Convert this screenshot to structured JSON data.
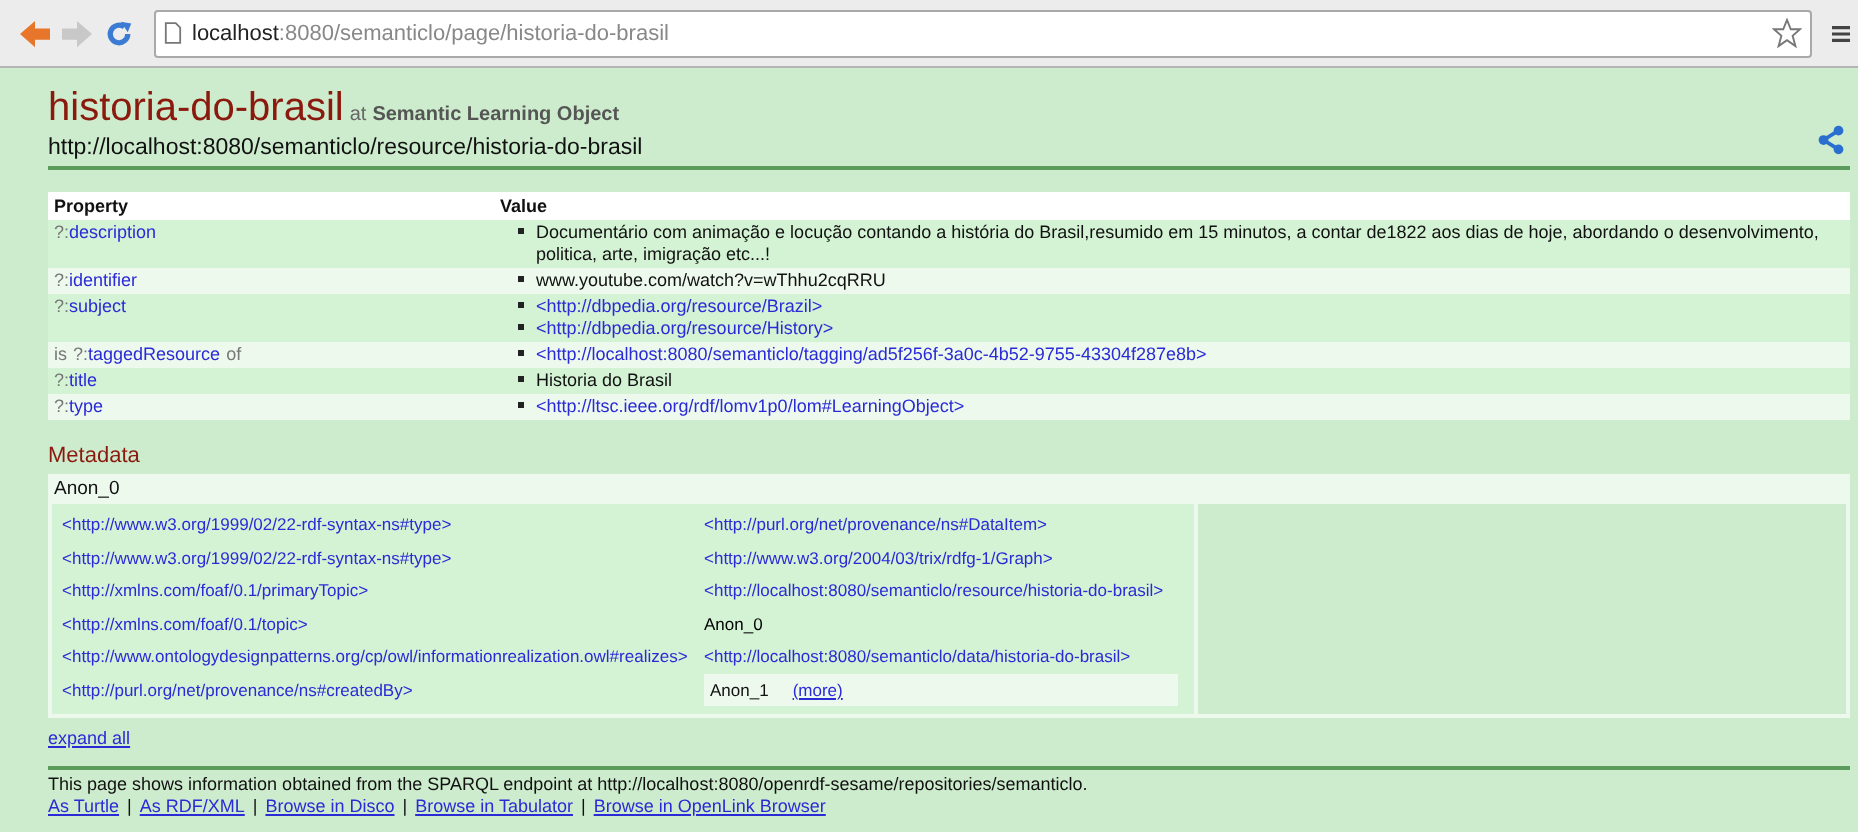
{
  "browser": {
    "url_host": "localhost",
    "url_path": ":8080/semanticlo/page/historia-do-brasil"
  },
  "header": {
    "title": "historia-do-brasil",
    "at": "at",
    "site": "Semantic Learning Object",
    "resource": "http://localhost:8080/semanticlo/resource/historia-do-brasil"
  },
  "properties": {
    "columns": [
      "Property",
      "Value"
    ],
    "rows": [
      {
        "property": {
          "prefix": "?:",
          "name": "description"
        },
        "values": [
          {
            "kind": "text",
            "text": "Documentário com animação e locução contando a história do Brasil,resumido em 15 minutos, a contar de1822 aos dias de hoje, abordando o desenvolvimento, politica, arte, imigração etc...!"
          }
        ]
      },
      {
        "property": {
          "prefix": "?:",
          "name": "identifier"
        },
        "values": [
          {
            "kind": "text",
            "text": "www.youtube.com/watch?v=wThhu2cqRRU"
          }
        ]
      },
      {
        "property": {
          "prefix": "?:",
          "name": "subject"
        },
        "values": [
          {
            "kind": "link",
            "text": "<http://dbpedia.org/resource/Brazil>"
          },
          {
            "kind": "link",
            "text": "<http://dbpedia.org/resource/History>"
          }
        ]
      },
      {
        "inverse_property": {
          "before": "is",
          "prefix": "?:",
          "name": "taggedResource",
          "after": "of"
        },
        "values": [
          {
            "kind": "link",
            "text": "<http://localhost:8080/semanticlo/tagging/ad5f256f-3a0c-4b52-9755-43304f287e8b>"
          }
        ]
      },
      {
        "property": {
          "prefix": "?:",
          "name": "title"
        },
        "values": [
          {
            "kind": "text",
            "text": "Historia do Brasil"
          }
        ]
      },
      {
        "property": {
          "prefix": "?:",
          "name": "type"
        },
        "values": [
          {
            "kind": "link",
            "text": "<http://ltsc.ieee.org/rdf/lomv1p0/lom#LearningObject>"
          }
        ]
      }
    ]
  },
  "metadata": {
    "heading": "Metadata",
    "node": "Anon_0",
    "rows": [
      {
        "predicate": "<http://www.w3.org/1999/02/22-rdf-syntax-ns#type>",
        "object": {
          "kind": "link",
          "text": "<http://purl.org/net/provenance/ns#DataItem>"
        }
      },
      {
        "predicate": "<http://www.w3.org/1999/02/22-rdf-syntax-ns#type>",
        "object": {
          "kind": "link",
          "text": "<http://www.w3.org/2004/03/trix/rdfg-1/Graph>"
        }
      },
      {
        "predicate": "<http://xmlns.com/foaf/0.1/primaryTopic>",
        "object": {
          "kind": "link",
          "text": "<http://localhost:8080/semanticlo/resource/historia-do-brasil>"
        }
      },
      {
        "predicate": "<http://xmlns.com/foaf/0.1/topic>",
        "object": {
          "kind": "text",
          "text": "Anon_0"
        }
      },
      {
        "predicate": "<http://www.ontologydesignpatterns.org/cp/owl/informationrealization.owl#realizes>",
        "object": {
          "kind": "link",
          "text": "<http://localhost:8080/semanticlo/data/historia-do-brasil>"
        }
      },
      {
        "predicate": "<http://purl.org/net/provenance/ns#createdBy>",
        "object": {
          "kind": "node",
          "text": "Anon_1",
          "more": "(more)"
        }
      }
    ],
    "expand": "expand all"
  },
  "footer": {
    "text": "This page shows information obtained from the SPARQL endpoint at http://localhost:8080/openrdf-sesame/repositories/semanticlo.",
    "links": [
      "As Turtle",
      "As RDF/XML",
      "Browse in Disco",
      "Browse in Tabulator",
      "Browse in OpenLink Browser"
    ],
    "separator": "|"
  }
}
